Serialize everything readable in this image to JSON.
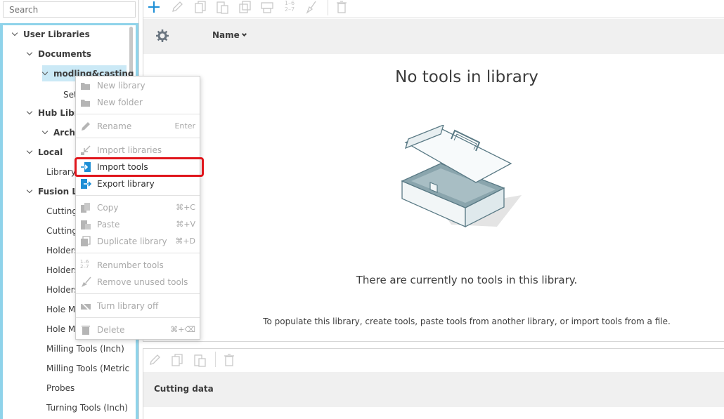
{
  "search": {
    "placeholder": "Search"
  },
  "tree": {
    "items": [
      {
        "label": "User Libraries",
        "level": 0,
        "expanded": true,
        "bold": false
      },
      {
        "label": "Documents",
        "level": 1,
        "expanded": true,
        "bold": true
      },
      {
        "label": "modling&casting",
        "level": 2,
        "expanded": true,
        "bold": true,
        "selected": true
      },
      {
        "label": "Set",
        "level": 3
      },
      {
        "label": "Hub Libra",
        "level": 1,
        "expanded": true,
        "bold": true
      },
      {
        "label": "Archi",
        "level": 2,
        "expanded": true,
        "bold": true
      },
      {
        "label": "Local",
        "level": 1,
        "expanded": true,
        "bold": true
      },
      {
        "label": "Library",
        "level": 2
      },
      {
        "label": "Fusion Lil",
        "level": 1,
        "expanded": true,
        "bold": true
      },
      {
        "label": "Cutting",
        "level": 2
      },
      {
        "label": "Cutting",
        "level": 2
      },
      {
        "label": "Holders",
        "level": 2
      },
      {
        "label": "Holders",
        "level": 2
      },
      {
        "label": "Holders",
        "level": 2
      },
      {
        "label": "Hole Ma",
        "level": 2
      },
      {
        "label": "Hole Ma",
        "level": 2
      },
      {
        "label": "Milling Tools (Inch)",
        "level": 2
      },
      {
        "label": "Milling Tools (Metric",
        "level": 2
      },
      {
        "label": "Probes",
        "level": 2
      },
      {
        "label": "Turning Tools (Inch)",
        "level": 2
      }
    ]
  },
  "toolbar": {
    "icons": [
      "add-tool-icon",
      "edit-icon",
      "copy-icon",
      "paste-icon",
      "duplicate-icon",
      "print-icon",
      "renumber-icon",
      "remove-unused-icon",
      "delete-icon"
    ],
    "renumber_text_top": "1–6",
    "renumber_text_bottom": "2–7"
  },
  "table_header": {
    "name_column": "Name"
  },
  "empty_state": {
    "title": "No tools in library",
    "message": "There are currently no tools in this library.",
    "hint": "To populate this library, create tools, paste tools from another library, or import tools from a file."
  },
  "bottom_panel": {
    "header": "Cutting data",
    "icons": [
      "edit-icon",
      "copy-icon",
      "paste-icon",
      "delete-icon"
    ]
  },
  "context_menu": {
    "items": [
      {
        "label": "New library",
        "shortcut": "",
        "enabled": false,
        "icon": "new-library-icon"
      },
      {
        "label": "New folder",
        "shortcut": "",
        "enabled": false,
        "icon": "new-folder-icon"
      },
      {
        "label": "Rename",
        "shortcut": "Enter",
        "enabled": false,
        "icon": "pencil-icon"
      },
      {
        "label": "Import libraries",
        "shortcut": "",
        "enabled": false,
        "icon": "import-libraries-icon"
      },
      {
        "label": "Import tools",
        "shortcut": "",
        "enabled": true,
        "icon": "import-tools-icon",
        "highlighted": true
      },
      {
        "label": "Export library",
        "shortcut": "",
        "enabled": true,
        "icon": "export-library-icon"
      },
      {
        "label": "Copy",
        "shortcut": "⌘+C",
        "enabled": false,
        "icon": "copy-icon"
      },
      {
        "label": "Paste",
        "shortcut": "⌘+V",
        "enabled": false,
        "icon": "paste-icon"
      },
      {
        "label": "Duplicate library",
        "shortcut": "⌘+D",
        "enabled": false,
        "icon": "duplicate-icon"
      },
      {
        "label": "Renumber tools",
        "shortcut": "",
        "enabled": false,
        "icon": "renumber-icon"
      },
      {
        "label": "Remove unused tools",
        "shortcut": "",
        "enabled": false,
        "icon": "broom-icon"
      },
      {
        "label": "Turn library off",
        "shortcut": "",
        "enabled": false,
        "icon": "library-off-icon"
      },
      {
        "label": "Delete",
        "shortcut": "⌘+⌫",
        "enabled": false,
        "icon": "trash-icon"
      }
    ]
  },
  "colors": {
    "accent": "#1e8fd6",
    "selection": "#cbe9f6",
    "frame": "#8fd3ea",
    "highlight": "#e0161c"
  }
}
